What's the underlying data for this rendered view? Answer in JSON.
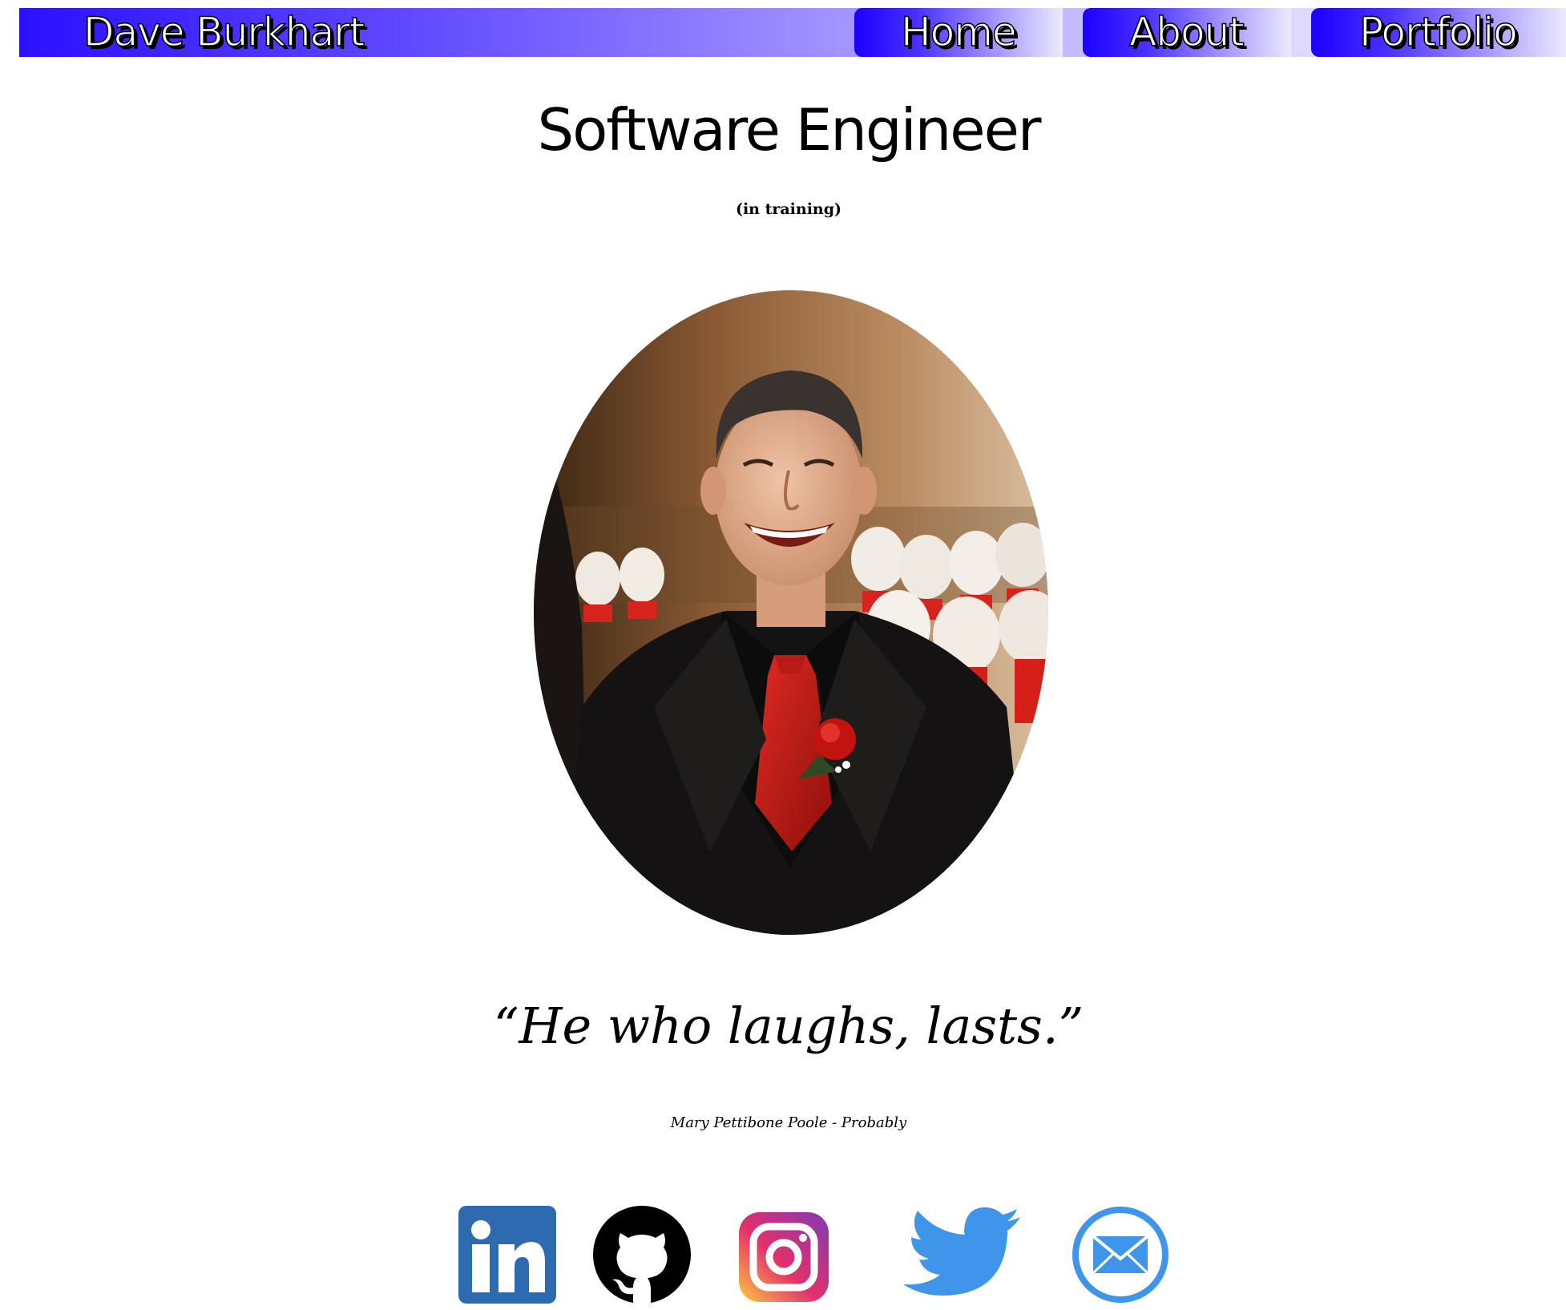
{
  "header": {
    "brand": "Dave Burkhart",
    "nav": [
      {
        "label": "Home"
      },
      {
        "label": "About"
      },
      {
        "label": "Portfolio"
      }
    ]
  },
  "main": {
    "title": "Software Engineer",
    "subtitle": "(in training)",
    "quote": "“He who laughs, lasts.”",
    "attribution": "Mary Pettibone Poole - Probably"
  },
  "social": [
    {
      "icon": "linkedin-icon"
    },
    {
      "icon": "github-icon"
    },
    {
      "icon": "instagram-icon"
    },
    {
      "icon": "twitter-icon"
    },
    {
      "icon": "email-icon"
    }
  ],
  "colors": {
    "header_start": "#2a10ff",
    "header_end": "#f4f2ff",
    "linkedin": "#2d6ab0",
    "instagram_start": "#fdc943",
    "instagram_mid": "#e1306c",
    "instagram_end": "#833ab4",
    "twitter": "#3e95e9",
    "email": "#3e95e9"
  }
}
